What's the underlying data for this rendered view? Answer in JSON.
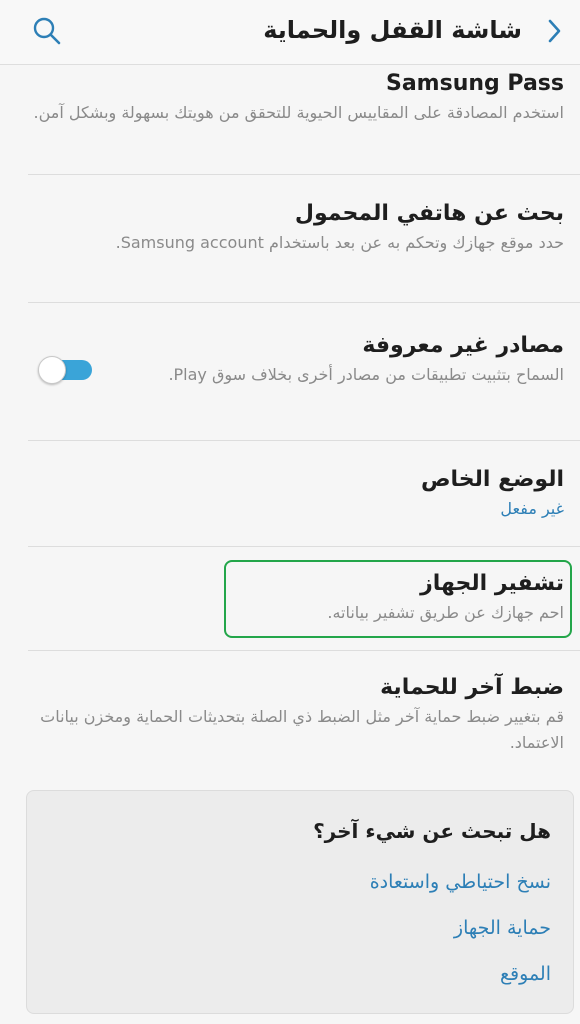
{
  "header": {
    "title": "شاشة القفل والحماية",
    "back_icon": "chevron-left-icon",
    "search_icon": "search-icon"
  },
  "items": [
    {
      "title": "Samsung Pass",
      "subtitle": "استخدم المصادقة على المقاييس الحيوية للتحقق من هويتك بسهولة وبشكل آمن."
    },
    {
      "title": "بحث عن هاتفي المحمول",
      "subtitle": "حدد موقع جهازك وتحكم به عن بعد باستخدام Samsung account."
    },
    {
      "title": "مصادر غير معروفة",
      "subtitle": "السماح بتثبيت تطبيقات من مصادر أخرى بخلاف سوق Play.",
      "toggle_on": true
    },
    {
      "title": "الوضع الخاص",
      "subtitle": "غير مفعل"
    },
    {
      "title": "تشفير الجهاز",
      "subtitle": "احم جهازك عن طريق تشفير بياناته."
    },
    {
      "title": "ضبط آخر للحماية",
      "subtitle": "قم بتغيير ضبط حماية آخر مثل الضبط ذي الصلة بتحديثات الحماية ومخزن بيانات الاعتماد."
    }
  ],
  "card": {
    "question": "هل تبحث عن شيء آخر؟",
    "links": [
      "نسخ احتياطي واستعادة",
      "حماية الجهاز",
      "الموقع"
    ]
  },
  "colors": {
    "accent": "#2d7fb6",
    "toggle": "#3aa4d8",
    "highlight": "#23a64a"
  }
}
